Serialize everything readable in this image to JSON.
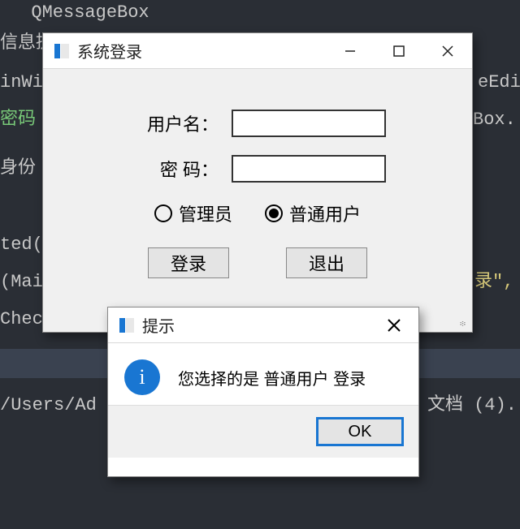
{
  "code": {
    "l1": "  QMessageBox",
    "l2": "信息提示框",
    "l3a": "inWi",
    "l3b": "eEdi",
    "l4a": "密码",
    "l4b": "Box.",
    "l5": "身份",
    "l6": "ted()",
    "l7a": "(Mai",
    "l7b": "录\",",
    "l8": "Chec",
    "l9a": "/Users/Ad",
    "l9b": "文档 (4)."
  },
  "loginWindow": {
    "title": "系统登录",
    "usernameLabel": "用户名：",
    "passwordLabel": "密 码：",
    "usernameValue": "",
    "passwordValue": "",
    "radios": {
      "admin": "管理员",
      "user": "普通用户",
      "selected": "user"
    },
    "buttons": {
      "login": "登录",
      "exit": "退出"
    }
  },
  "messageBox": {
    "title": "提示",
    "text": "您选择的是 普通用户  登录",
    "ok": "OK"
  },
  "icons": {
    "info": "i"
  }
}
